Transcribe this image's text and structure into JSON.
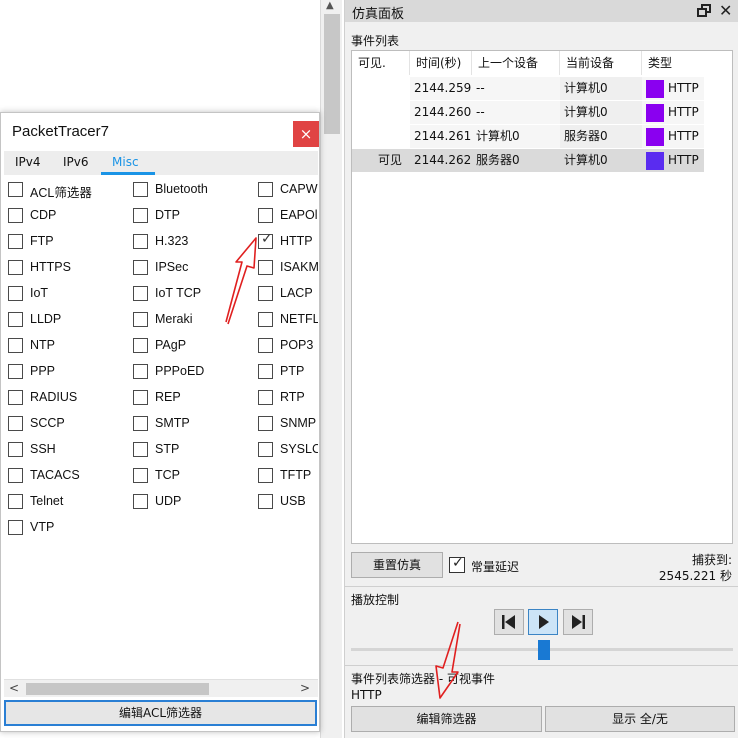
{
  "dialog": {
    "title": "PacketTracer7",
    "close_glyph": "×",
    "tabs": [
      "IPv4",
      "IPv6",
      "Misc"
    ],
    "active_tab": "Misc",
    "protocols": [
      {
        "label": "ACL筛选器",
        "checked": false
      },
      {
        "label": "Bluetooth",
        "checked": false
      },
      {
        "label": "CAPW",
        "checked": false
      },
      {
        "label": "CDP",
        "checked": false
      },
      {
        "label": "DTP",
        "checked": false
      },
      {
        "label": "EAPOl",
        "checked": false
      },
      {
        "label": "FTP",
        "checked": false
      },
      {
        "label": "H.323",
        "checked": false
      },
      {
        "label": "HTTP",
        "checked": true
      },
      {
        "label": "HTTPS",
        "checked": false
      },
      {
        "label": "IPSec",
        "checked": false
      },
      {
        "label": "ISAKM",
        "checked": false
      },
      {
        "label": "IoT",
        "checked": false
      },
      {
        "label": "IoT TCP",
        "checked": false
      },
      {
        "label": "LACP",
        "checked": false
      },
      {
        "label": "LLDP",
        "checked": false
      },
      {
        "label": "Meraki",
        "checked": false
      },
      {
        "label": "NETFL",
        "checked": false
      },
      {
        "label": "NTP",
        "checked": false
      },
      {
        "label": "PAgP",
        "checked": false
      },
      {
        "label": "POP3",
        "checked": false
      },
      {
        "label": "PPP",
        "checked": false
      },
      {
        "label": "PPPoED",
        "checked": false
      },
      {
        "label": "PTP",
        "checked": false
      },
      {
        "label": "RADIUS",
        "checked": false
      },
      {
        "label": "REP",
        "checked": false
      },
      {
        "label": "RTP",
        "checked": false
      },
      {
        "label": "SCCP",
        "checked": false
      },
      {
        "label": "SMTP",
        "checked": false
      },
      {
        "label": "SNMP",
        "checked": false
      },
      {
        "label": "SSH",
        "checked": false
      },
      {
        "label": "STP",
        "checked": false
      },
      {
        "label": "SYSLC",
        "checked": false
      },
      {
        "label": "TACACS",
        "checked": false
      },
      {
        "label": "TCP",
        "checked": false
      },
      {
        "label": "TFTP",
        "checked": false
      },
      {
        "label": "Telnet",
        "checked": false
      },
      {
        "label": "UDP",
        "checked": false
      },
      {
        "label": "USB",
        "checked": false
      },
      {
        "label": "VTP",
        "checked": false
      }
    ],
    "edit_acl_button": "编辑ACL筛选器",
    "scroll_left": "<",
    "scroll_right": ">"
  },
  "sim": {
    "title": "仿真面板",
    "close_glyph": "✕",
    "event_list_label": "事件列表",
    "columns": [
      "可见.",
      "时间(秒)",
      "上一个设备",
      "当前设备",
      "类型"
    ],
    "events": [
      {
        "visible": "",
        "time": "2144.259",
        "last_device": "--",
        "current_device": "计算机0",
        "type": "HTTP",
        "color": "#8a00f0"
      },
      {
        "visible": "",
        "time": "2144.260",
        "last_device": "--",
        "current_device": "计算机0",
        "type": "HTTP",
        "color": "#8a00f0"
      },
      {
        "visible": "",
        "time": "2144.261",
        "last_device": "计算机0",
        "current_device": "服务器0",
        "type": "HTTP",
        "color": "#8a00f0"
      },
      {
        "visible": "可见",
        "time": "2144.262",
        "last_device": "服务器0",
        "current_device": "计算机0",
        "type": "HTTP",
        "color": "#5a2cf0"
      }
    ],
    "reset_button": "重置仿真",
    "constant_delay_label": "常量延迟",
    "constant_delay_checked": true,
    "captured_label": "捕获到:",
    "captured_value": "2545.221 秒",
    "playback_label": "播放控制",
    "playback_buttons": [
      "back-step",
      "play",
      "forward-step"
    ],
    "filters_label": "事件列表筛选器 - 可视事件",
    "filters_value": "HTTP",
    "edit_filters_button": "编辑筛选器",
    "show_all_button": "显示 全/无",
    "accent_color": "#1a94e6",
    "annotation_color": "#e02020"
  }
}
